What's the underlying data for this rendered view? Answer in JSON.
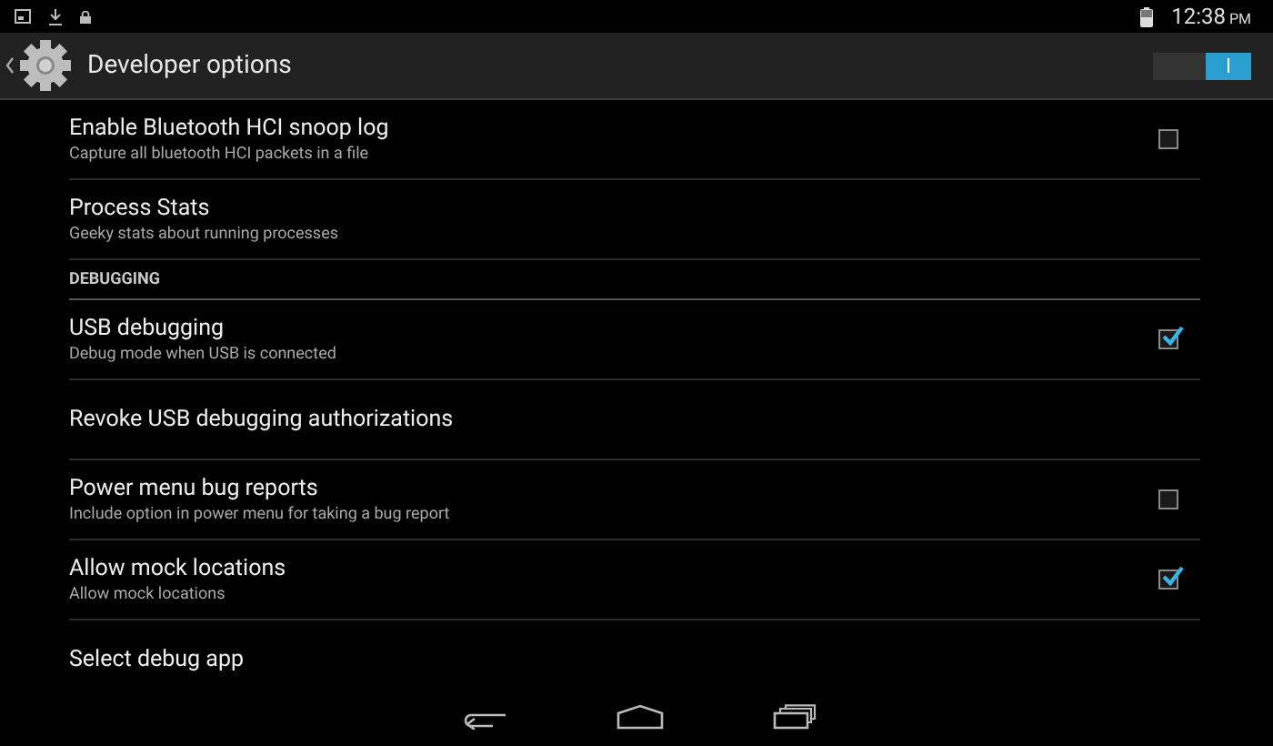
{
  "status_bar": {
    "time": "12:38",
    "ampm": "PM"
  },
  "action_bar": {
    "title": "Developer options",
    "master_switch": {
      "on": true
    }
  },
  "items": [
    {
      "kind": "checkbox",
      "title": "Enable Bluetooth HCI snoop log",
      "subtitle": "Capture all bluetooth HCI packets in a file",
      "checked": false
    },
    {
      "kind": "plain",
      "title": "Process Stats",
      "subtitle": "Geeky stats about running processes"
    },
    {
      "kind": "header",
      "title": "DEBUGGING"
    },
    {
      "kind": "checkbox",
      "title": "USB debugging",
      "subtitle": "Debug mode when USB is connected",
      "checked": true
    },
    {
      "kind": "plain",
      "title": "Revoke USB debugging authorizations"
    },
    {
      "kind": "checkbox",
      "title": "Power menu bug reports",
      "subtitle": "Include option in power menu for taking a bug report",
      "checked": false
    },
    {
      "kind": "checkbox",
      "title": "Allow mock locations",
      "subtitle": "Allow mock locations",
      "checked": true
    },
    {
      "kind": "plain",
      "title": "Select debug app"
    }
  ]
}
